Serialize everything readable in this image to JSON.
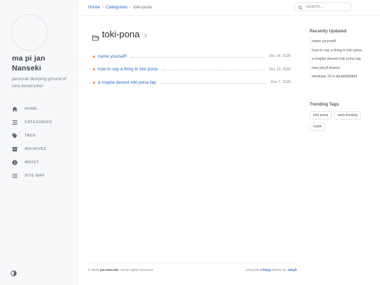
{
  "sidebar": {
    "site_title": "ma pi jan Nanseki",
    "site_subtitle": "personal dumping ground of very bored joker",
    "nav": [
      {
        "label": "HOME",
        "icon": "home-icon"
      },
      {
        "label": "CATEGORIES",
        "icon": "stream-icon"
      },
      {
        "label": "TAGS",
        "icon": "tag-icon"
      },
      {
        "label": "ARCHIVES",
        "icon": "archive-icon"
      },
      {
        "label": "ABOUT",
        "icon": "info-icon"
      },
      {
        "label": "SITE MAP",
        "icon": "list-icon"
      }
    ]
  },
  "topbar": {
    "breadcrumb": {
      "home": "Home",
      "categories": "Categories",
      "current": "toki-pona"
    },
    "search_placeholder": "Search..."
  },
  "main": {
    "category": "toki-pona",
    "count": "3",
    "posts": [
      {
        "title": "name yourself!",
        "date": "Dec 14, 2025"
      },
      {
        "title": "how to say a thing in toki pona",
        "date": "Dec 10, 2025"
      },
      {
        "title": "a maybe decent toki pona faq",
        "date": "Dec 7, 2025"
      }
    ]
  },
  "panel": {
    "recent_heading": "Recently Updated",
    "recent": [
      "name yourself!",
      "how to say a thing in toki pona",
      "a maybe decent toki pona faq",
      "new jekyll theme!",
      "windows 10 is deaddddddd"
    ],
    "trending_heading": "Trending Tags",
    "tags": [
      "toki-pona",
      "web-hosting",
      "nasin"
    ]
  },
  "footer": {
    "copyright": "© 2025",
    "author": "jan Nanseki",
    "rights": ". Some rights reserved.",
    "using": "Using the",
    "theme": "Chirpy",
    "theme_for": "theme for",
    "engine": "Jekyll",
    "end": "."
  },
  "colors": {
    "accent": "#2a6bbf",
    "bullet": "#ea8b47",
    "sidebar_bg": "#f6f8fa"
  }
}
